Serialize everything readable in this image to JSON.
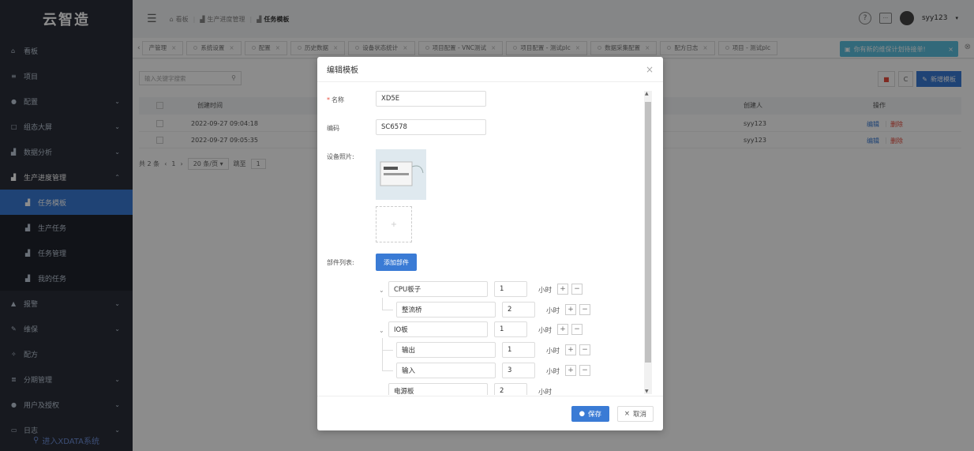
{
  "app": {
    "logo": "云智造",
    "xdata": "进入XDATA系统"
  },
  "sidebar": {
    "items": [
      {
        "label": "看板",
        "icon": "home-icon"
      },
      {
        "label": "项目",
        "icon": "list-icon"
      },
      {
        "label": "配置",
        "icon": "settings-icon",
        "chev": "⌄"
      },
      {
        "label": "组态大屏",
        "icon": "screen-icon",
        "chev": "⌄"
      },
      {
        "label": "数据分析",
        "icon": "chart-icon",
        "chev": "⌄"
      },
      {
        "label": "生产进度管理",
        "icon": "chart-icon",
        "chev": "⌃"
      }
    ],
    "sub": [
      {
        "label": "任务模板"
      },
      {
        "label": "生产任务"
      },
      {
        "label": "任务管理"
      },
      {
        "label": "我的任务"
      }
    ],
    "items2": [
      {
        "label": "报警",
        "icon": "bell-icon",
        "chev": "⌄"
      },
      {
        "label": "维保",
        "icon": "wrench-icon",
        "chev": "⌄"
      },
      {
        "label": "配方",
        "icon": "recipe-icon"
      },
      {
        "label": "分期管理",
        "icon": "installment-icon",
        "chev": "⌄"
      },
      {
        "label": "用户及授权",
        "icon": "user-icon",
        "chev": "⌄"
      },
      {
        "label": "日志",
        "icon": "log-icon",
        "chev": "⌄"
      }
    ]
  },
  "header": {
    "breadcrumb": [
      "看板",
      "生产进度管理",
      "任务模板"
    ],
    "username": "syy123"
  },
  "tags": [
    "产管理",
    "系统设置",
    "配置",
    "历史数据",
    "设备状态统计",
    "项目配置 - VNC测试",
    "项目配置 - 测试plc",
    "数据采集配置",
    "配方日志",
    "项目 - 测试plc"
  ],
  "toast": "你有新的维保计划待接单!",
  "content": {
    "search_placeholder": "输入关键字搜索",
    "add_button": "新增模板",
    "columns": {
      "created": "创建时间",
      "creator": "创建人",
      "action": "操作"
    },
    "rows": [
      {
        "created": "2022-09-27 09:04:18",
        "creator": "syy123",
        "edit": "编辑",
        "delete": "删除"
      },
      {
        "created": "2022-09-27 09:05:35",
        "creator": "syy123",
        "edit": "编辑",
        "delete": "删除"
      }
    ],
    "pager": {
      "total": "共 2 条",
      "page": "1",
      "size": "20 条/页",
      "goto": "跳至",
      "goto_val": "1"
    }
  },
  "modal": {
    "title": "编辑模板",
    "name_label": "名称",
    "name_value": "XD5E",
    "code_label": "编码",
    "code_value": "SC6578",
    "photo_label": "设备照片:",
    "parts_label": "部件列表:",
    "add_part": "添加部件",
    "unit": "小时",
    "parts": [
      {
        "name": "CPU板子",
        "hours": "1"
      },
      {
        "name": "整流桥",
        "hours": "2"
      },
      {
        "name": "IO板",
        "hours": "1"
      },
      {
        "name": "输出",
        "hours": "1"
      },
      {
        "name": "输入",
        "hours": "3"
      },
      {
        "name": "电源板",
        "hours": "2"
      }
    ],
    "save": "保存",
    "cancel": "取消"
  }
}
